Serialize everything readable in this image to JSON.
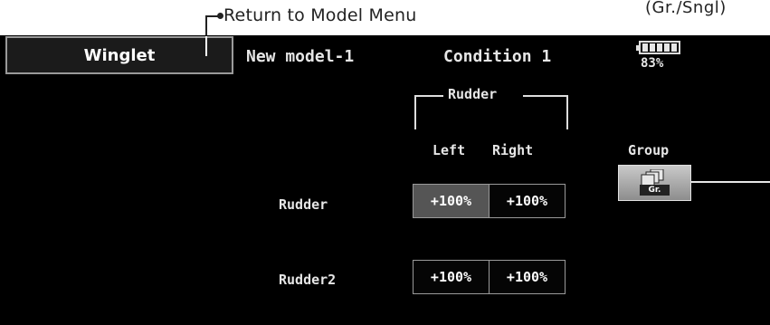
{
  "annotation": {
    "return_label": "Return to Model Menu",
    "corner_label": "(Gr./Sngl)"
  },
  "header": {
    "title": "Winglet",
    "model": "New model-1",
    "condition": "Condition 1",
    "battery_percent": "83%",
    "battery_level": 0.83
  },
  "rudder_group": {
    "label": "Rudder",
    "col_left": "Left",
    "col_right": "Right"
  },
  "rows": [
    {
      "label": "Rudder",
      "left": "+100%",
      "right": "+100%"
    },
    {
      "label": "Rudder2",
      "left": "+100%",
      "right": "+100%"
    }
  ],
  "group": {
    "label": "Group",
    "button_text": "Gr."
  },
  "colors": {
    "screen_bg": "#000000",
    "selected_cell": "#555555",
    "text": "#e6e6e6"
  }
}
